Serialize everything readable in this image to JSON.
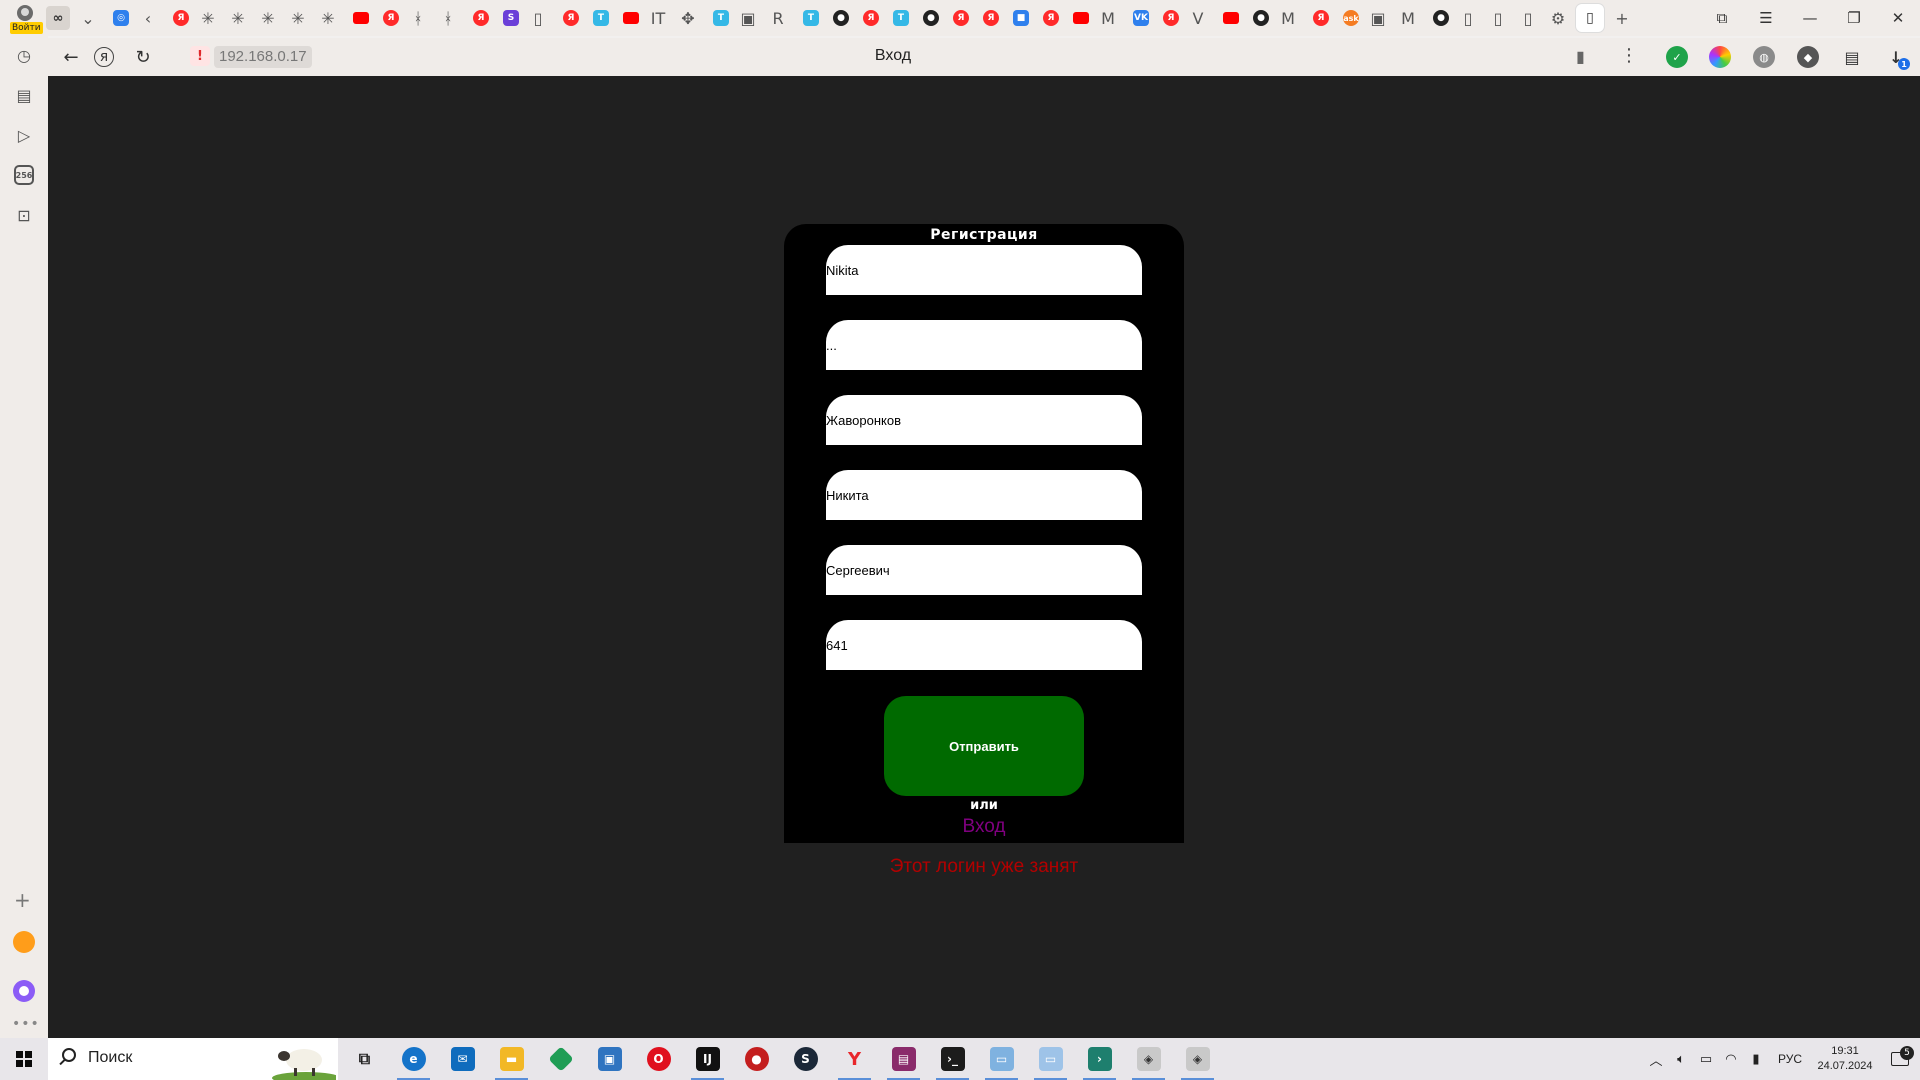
{
  "browser": {
    "profile_label": "Войти",
    "address": "192.168.0.17",
    "page_title": "Вход",
    "downloads_badge": "1"
  },
  "tabs": [
    {
      "icon": "infinity-icon",
      "glyph": "∞"
    },
    {
      "icon": "chevron-down-icon",
      "glyph": "⌄"
    },
    {
      "icon": "app-icon",
      "glyph": "◎"
    },
    {
      "icon": "back-tab-icon",
      "glyph": "‹"
    },
    {
      "icon": "yandex-icon",
      "glyph": "Я"
    },
    {
      "icon": "asterisk-icon",
      "glyph": "✳"
    },
    {
      "icon": "asterisk-icon",
      "glyph": "✳"
    },
    {
      "icon": "asterisk-icon",
      "glyph": "✳"
    },
    {
      "icon": "asterisk-icon",
      "glyph": "✳"
    },
    {
      "icon": "asterisk-icon",
      "glyph": "✳"
    },
    {
      "icon": "youtube-icon",
      "glyph": "▶"
    },
    {
      "icon": "yandex-icon",
      "glyph": "Я"
    },
    {
      "icon": "figure-icon",
      "glyph": "ᚼ"
    },
    {
      "icon": "figure-icon",
      "glyph": "ᚼ"
    },
    {
      "icon": "yandex-icon",
      "glyph": "Я"
    },
    {
      "icon": "s-icon",
      "glyph": "S"
    },
    {
      "icon": "doc-icon",
      "glyph": "▯"
    },
    {
      "icon": "yandex-icon",
      "glyph": "Я"
    },
    {
      "icon": "t-icon",
      "glyph": "T"
    },
    {
      "icon": "youtube-icon",
      "glyph": "▶"
    },
    {
      "icon": "it-icon",
      "glyph": "IT"
    },
    {
      "icon": "arrows-icon",
      "glyph": "✥"
    },
    {
      "icon": "t-icon",
      "glyph": "T"
    },
    {
      "icon": "image-icon",
      "glyph": "▣"
    },
    {
      "icon": "r-icon",
      "glyph": "R"
    },
    {
      "icon": "t-icon",
      "glyph": "T"
    },
    {
      "icon": "chat-icon",
      "glyph": "●"
    },
    {
      "icon": "yandex-icon",
      "glyph": "Я"
    },
    {
      "icon": "t-icon",
      "glyph": "T"
    },
    {
      "icon": "chat-icon",
      "glyph": "●"
    },
    {
      "icon": "yandex-icon",
      "glyph": "Я"
    },
    {
      "icon": "yandex-icon",
      "glyph": "Я"
    },
    {
      "icon": "windows-icon",
      "glyph": "■"
    },
    {
      "icon": "yandex-icon",
      "glyph": "Я"
    },
    {
      "icon": "youtube-icon",
      "glyph": "▶"
    },
    {
      "icon": "gmail-icon",
      "glyph": "M"
    },
    {
      "icon": "vk-icon",
      "glyph": "VK"
    },
    {
      "icon": "yandex-icon",
      "glyph": "Я"
    },
    {
      "icon": "v-icon",
      "glyph": "V"
    },
    {
      "icon": "youtube-icon",
      "glyph": "▶"
    },
    {
      "icon": "github-icon",
      "glyph": "●"
    },
    {
      "icon": "gmail-icon",
      "glyph": "M"
    },
    {
      "icon": "yandex-icon",
      "glyph": "Я"
    },
    {
      "icon": "ask-icon",
      "glyph": "ask"
    },
    {
      "icon": "window-icon",
      "glyph": "▣"
    },
    {
      "icon": "gmail-icon",
      "glyph": "M"
    },
    {
      "icon": "github-icon",
      "glyph": "●"
    },
    {
      "icon": "doc-icon",
      "glyph": "▯"
    },
    {
      "icon": "doc-icon",
      "glyph": "▯"
    },
    {
      "icon": "doc-icon",
      "glyph": "▯"
    },
    {
      "icon": "settings-icon",
      "glyph": "⚙"
    },
    {
      "icon": "doc-icon",
      "glyph": "▯"
    },
    {
      "icon": "new-tab-icon",
      "glyph": "+"
    }
  ],
  "form": {
    "title": "Регистрация",
    "fields": [
      {
        "name": "login-field",
        "type": "text",
        "value": "Nikita"
      },
      {
        "name": "password-field",
        "type": "password",
        "value": "..."
      },
      {
        "name": "surname-field",
        "type": "text",
        "value": "Жаворонков"
      },
      {
        "name": "first-name-field",
        "type": "text",
        "value": "Никита"
      },
      {
        "name": "patronymic-field",
        "type": "text",
        "value": "Сергеевич"
      },
      {
        "name": "group-field",
        "type": "text",
        "value": "641"
      }
    ],
    "submit_label": "Отправить",
    "or_label": "или",
    "login_link": "Вход",
    "error_message": "Этот логин уже занят",
    "colors": {
      "card_bg": "#000000",
      "submit_bg": "#006a00",
      "link": "#800080",
      "error": "#b30000",
      "page_bg": "#202020"
    }
  },
  "taskbar": {
    "search_placeholder": "Поиск",
    "lang": "РУС",
    "time": "19:31",
    "date": "24.07.2024",
    "notifications_count": "5"
  }
}
